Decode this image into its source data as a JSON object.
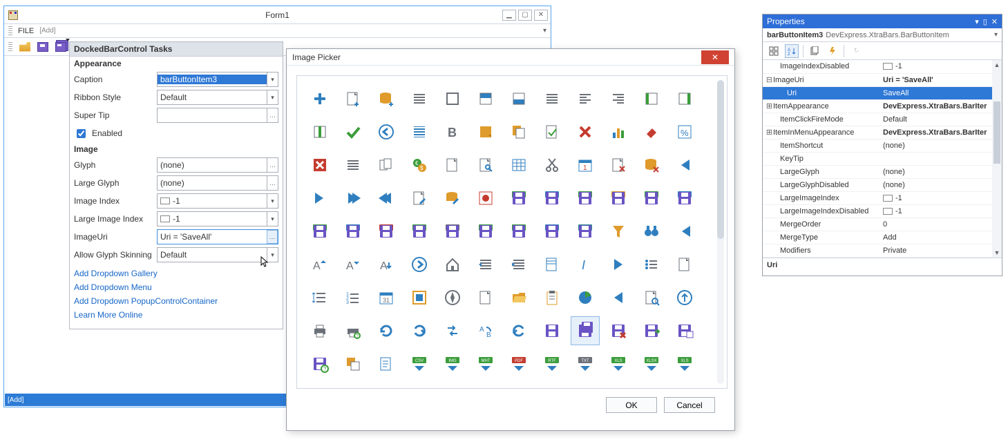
{
  "form": {
    "title": "Form1",
    "minimize": "▁",
    "maximize": "▢",
    "close": "✕",
    "file": "FILE",
    "add_hint": "[Add]",
    "bottom_add": "[Add]"
  },
  "smarttag": {
    "header": "DockedBarControl Tasks",
    "appearance_section": "Appearance",
    "image_section": "Image",
    "caption_lbl": "Caption",
    "caption_val": "barButtonItem3",
    "ribbon_lbl": "Ribbon Style",
    "ribbon_val": "Default",
    "supertip_lbl": "Super Tip",
    "supertip_val": "",
    "enabled_lbl": "Enabled",
    "glyph_lbl": "Glyph",
    "glyph_val": "(none)",
    "largeglyph_lbl": "Large Glyph",
    "largeglyph_val": "(none)",
    "imgindex_lbl": "Image Index",
    "imgindex_val": "-1",
    "limgindex_lbl": "Large Image Index",
    "limgindex_val": "-1",
    "imageuri_lbl": "ImageUri",
    "imageuri_val": "Uri = 'SaveAll'",
    "allowglyph_lbl": "Allow Glyph Skinning",
    "allowglyph_val": "Default",
    "link1": "Add Dropdown Gallery",
    "link2": "Add Dropdown Menu",
    "link3": "Add Dropdown PopupControlContainer",
    "link4": "Learn More Online"
  },
  "picker": {
    "title": "Image Picker",
    "ok": "OK",
    "cancel": "Cancel",
    "selected": "SaveAll",
    "icons": [
      "Add",
      "AddFile",
      "AddDatabase",
      "AlignCenter",
      "AlignFull",
      "AlignTop",
      "AlignBottom",
      "AlignJustify",
      "AlignLeft",
      "AlignRight",
      "BorderLeft",
      "BorderRight",
      "BorderInside",
      "Apply",
      "Back",
      "Paragraph",
      "Bold",
      "Note",
      "Copy",
      "NoteCheck",
      "Close",
      "BarChart",
      "Erase",
      "Percent",
      "CloseBox",
      "ListNumbered",
      "Pages",
      "Currency",
      "Page",
      "PageWrench",
      "Table",
      "Cut",
      "Calendar",
      "CancelFile",
      "DeleteDb",
      "SkipFirst",
      "SkipLast",
      "Play",
      "Rewind",
      "EditPage",
      "EditDb",
      "Bug",
      "ExportCsv",
      "ExportDoc",
      "ExportEpub",
      "ExportHtml",
      "ExportImg",
      "ExportXml",
      "ExportMht",
      "ExportOdt",
      "ExportPdf",
      "ExportRtf",
      "ExportTxt",
      "ExportXls",
      "ExportXlsx",
      "ExportXml2",
      "ExportXps",
      "Filter",
      "Binoculars",
      "PrevTrack",
      "FontSizeInc",
      "FontSizeDec",
      "Font",
      "Forward",
      "Home",
      "IndentInc",
      "IndentDec",
      "InsertPage",
      "Italic",
      "NextTrack",
      "BulletList",
      "Blank",
      "LineSpacing",
      "NumberedList",
      "Month",
      "Frame",
      "Compass",
      "NewPage",
      "OpenFolder",
      "Clipboard",
      "PieChart",
      "PlayPrev",
      "ZoomPage",
      "Up",
      "Print",
      "PrintPreview",
      "Refresh",
      "Redo",
      "Replace",
      "ReplaceAB",
      "Undo",
      "Save",
      "SaveAll",
      "SaveClose",
      "SaveExport",
      "SaveLayout",
      "SavePrompt",
      "SendBack",
      "Script",
      "SendCsv",
      "SendImg",
      "SendMht",
      "SendPdf",
      "SendRtf",
      "SendTxt",
      "SendXls",
      "SendXlsx",
      "SendXls2"
    ]
  },
  "props": {
    "title": "Properties",
    "obj_name": "barButtonItem3",
    "obj_type": "DevExpress.XtraBars.BarButtonItem",
    "description_title": "Uri",
    "rows": [
      {
        "indent": 1,
        "exp": "",
        "k": "ImageIndexDisabled",
        "v": "-1",
        "swatch": true
      },
      {
        "indent": 0,
        "exp": "⊟",
        "k": "ImageUri",
        "v": "Uri = 'SaveAll'",
        "bold": true
      },
      {
        "indent": 2,
        "exp": "",
        "k": "Uri",
        "v": "SaveAll",
        "sel": true
      },
      {
        "indent": 0,
        "exp": "⊞",
        "k": "ItemAppearance",
        "v": "DevExpress.XtraBars.BarIter",
        "bold": true
      },
      {
        "indent": 1,
        "exp": "",
        "k": "ItemClickFireMode",
        "v": "Default"
      },
      {
        "indent": 0,
        "exp": "⊞",
        "k": "ItemInMenuAppearance",
        "v": "DevExpress.XtraBars.BarIter",
        "bold": true
      },
      {
        "indent": 1,
        "exp": "",
        "k": "ItemShortcut",
        "v": "(none)"
      },
      {
        "indent": 1,
        "exp": "",
        "k": "KeyTip",
        "v": ""
      },
      {
        "indent": 1,
        "exp": "",
        "k": "LargeGlyph",
        "v": "(none)"
      },
      {
        "indent": 1,
        "exp": "",
        "k": "LargeGlyphDisabled",
        "v": "(none)"
      },
      {
        "indent": 1,
        "exp": "",
        "k": "LargeImageIndex",
        "v": "-1",
        "swatch": true
      },
      {
        "indent": 1,
        "exp": "",
        "k": "LargeImageIndexDisabled",
        "v": "-1",
        "swatch": true
      },
      {
        "indent": 1,
        "exp": "",
        "k": "MergeOrder",
        "v": "0"
      },
      {
        "indent": 1,
        "exp": "",
        "k": "MergeType",
        "v": "Add"
      },
      {
        "indent": 1,
        "exp": "",
        "k": "Modifiers",
        "v": "Private"
      }
    ]
  }
}
